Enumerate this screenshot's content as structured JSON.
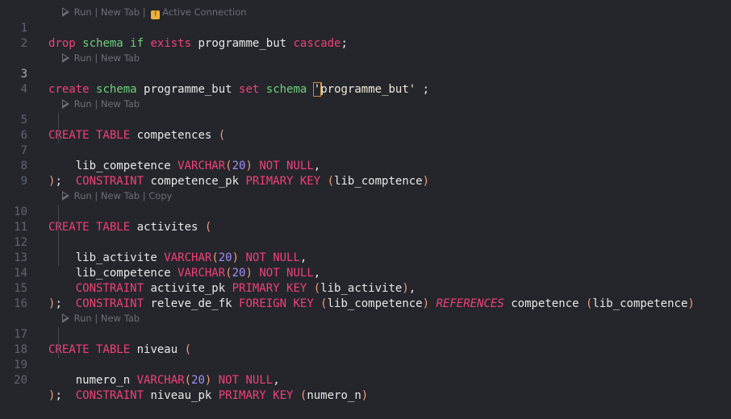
{
  "colors": {
    "background": "#25262c",
    "keyword": "#f1407a",
    "schema_keyword": "#6fd17a",
    "number": "#a28ef2",
    "line_number": "#5f6570",
    "codelens": "#6c6f78"
  },
  "codelens": {
    "l0": {
      "text": "Run | New Tab | ",
      "extra": "Active Connection"
    },
    "l1": "Run | New Tab",
    "l2": "Run | New Tab",
    "l3": "Run | New Tab | Copy",
    "l4": "Run | New Tab"
  },
  "lines": {
    "n1": "1",
    "n2": "2",
    "n3": "3",
    "n4": "4",
    "n5": "5",
    "n6": "6",
    "n7": "7",
    "n8": "8",
    "n9": "9",
    "n10": "10",
    "n11": "11",
    "n12": "12",
    "n13": "13",
    "n14": "14",
    "n15": "15",
    "n16": "16",
    "n17": "17",
    "n18": "18",
    "n19": "19",
    "n20": "20"
  },
  "code": {
    "l1": {
      "drop": "drop",
      "schema": "schema",
      "if": "if",
      "exists": "exists",
      "name": " programme_but ",
      "cascade": "cascade",
      "semi": ";"
    },
    "l3": {
      "create": "create",
      "schema": "schema",
      "name": " programme_but ",
      "set": "set",
      "schema2": "schema",
      "str_open": "'",
      "str_body": "programme_but'",
      "tail": " ;"
    },
    "l5": {
      "create": "CREATE TABLE",
      "name": " competences ",
      "open": "("
    },
    "l6": {
      "col": "lib_competence ",
      "type": "VARCHAR",
      "o": "(",
      "num": "20",
      "c": ")",
      "nn": " NOT NULL",
      "comma": ","
    },
    "l7": {
      "kw": "CONSTRAINT",
      "name": " competence_pk ",
      "pk": "PRIMARY KEY",
      "o": " (",
      "col": "lib_comptence",
      "c": ")"
    },
    "l8": {
      "close": ")",
      "semi": ";"
    },
    "l10": {
      "create": "CREATE TABLE",
      "name": " activites ",
      "open": "("
    },
    "l11": {
      "col": "lib_activite ",
      "type": "VARCHAR",
      "o": "(",
      "num": "20",
      "c": ")",
      "nn": " NOT NULL",
      "comma": ","
    },
    "l12": {
      "col": "lib_competence ",
      "type": "VARCHAR",
      "o": "(",
      "num": "20",
      "c": ")",
      "nn": " NOT NULL",
      "comma": ","
    },
    "l13": {
      "kw": "CONSTRAINT",
      "name": " activite_pk ",
      "pk": "PRIMARY KEY",
      "o": " (",
      "col": "lib_activite",
      "c": ")",
      "comma": ","
    },
    "l14": {
      "kw": "CONSTRAINT",
      "name": " releve_de_fk ",
      "fk": "FOREIGN KEY",
      "o": " (",
      "col": "lib_competence",
      "c": ")",
      "ref": " REFERENCES",
      "tbl": " competence ",
      "o2": "(",
      "col2": "lib_competence",
      "c2": ")"
    },
    "l15": {
      "close": ")",
      "semi": ";"
    },
    "l17": {
      "create": "CREATE TABLE",
      "name": " niveau ",
      "open": "("
    },
    "l18": {
      "col": "numero_n ",
      "type": "VARCHAR",
      "o": "(",
      "num": "20",
      "c": ")",
      "nn": " NOT NULL",
      "comma": ","
    },
    "l19": {
      "kw": "CONSTRAINT",
      "name": " niveau_pk ",
      "pk": "PRIMARY KEY",
      "o": " (",
      "col": "numero_n",
      "c": ")"
    },
    "l20": {
      "close": ")",
      "semi": ";"
    }
  }
}
